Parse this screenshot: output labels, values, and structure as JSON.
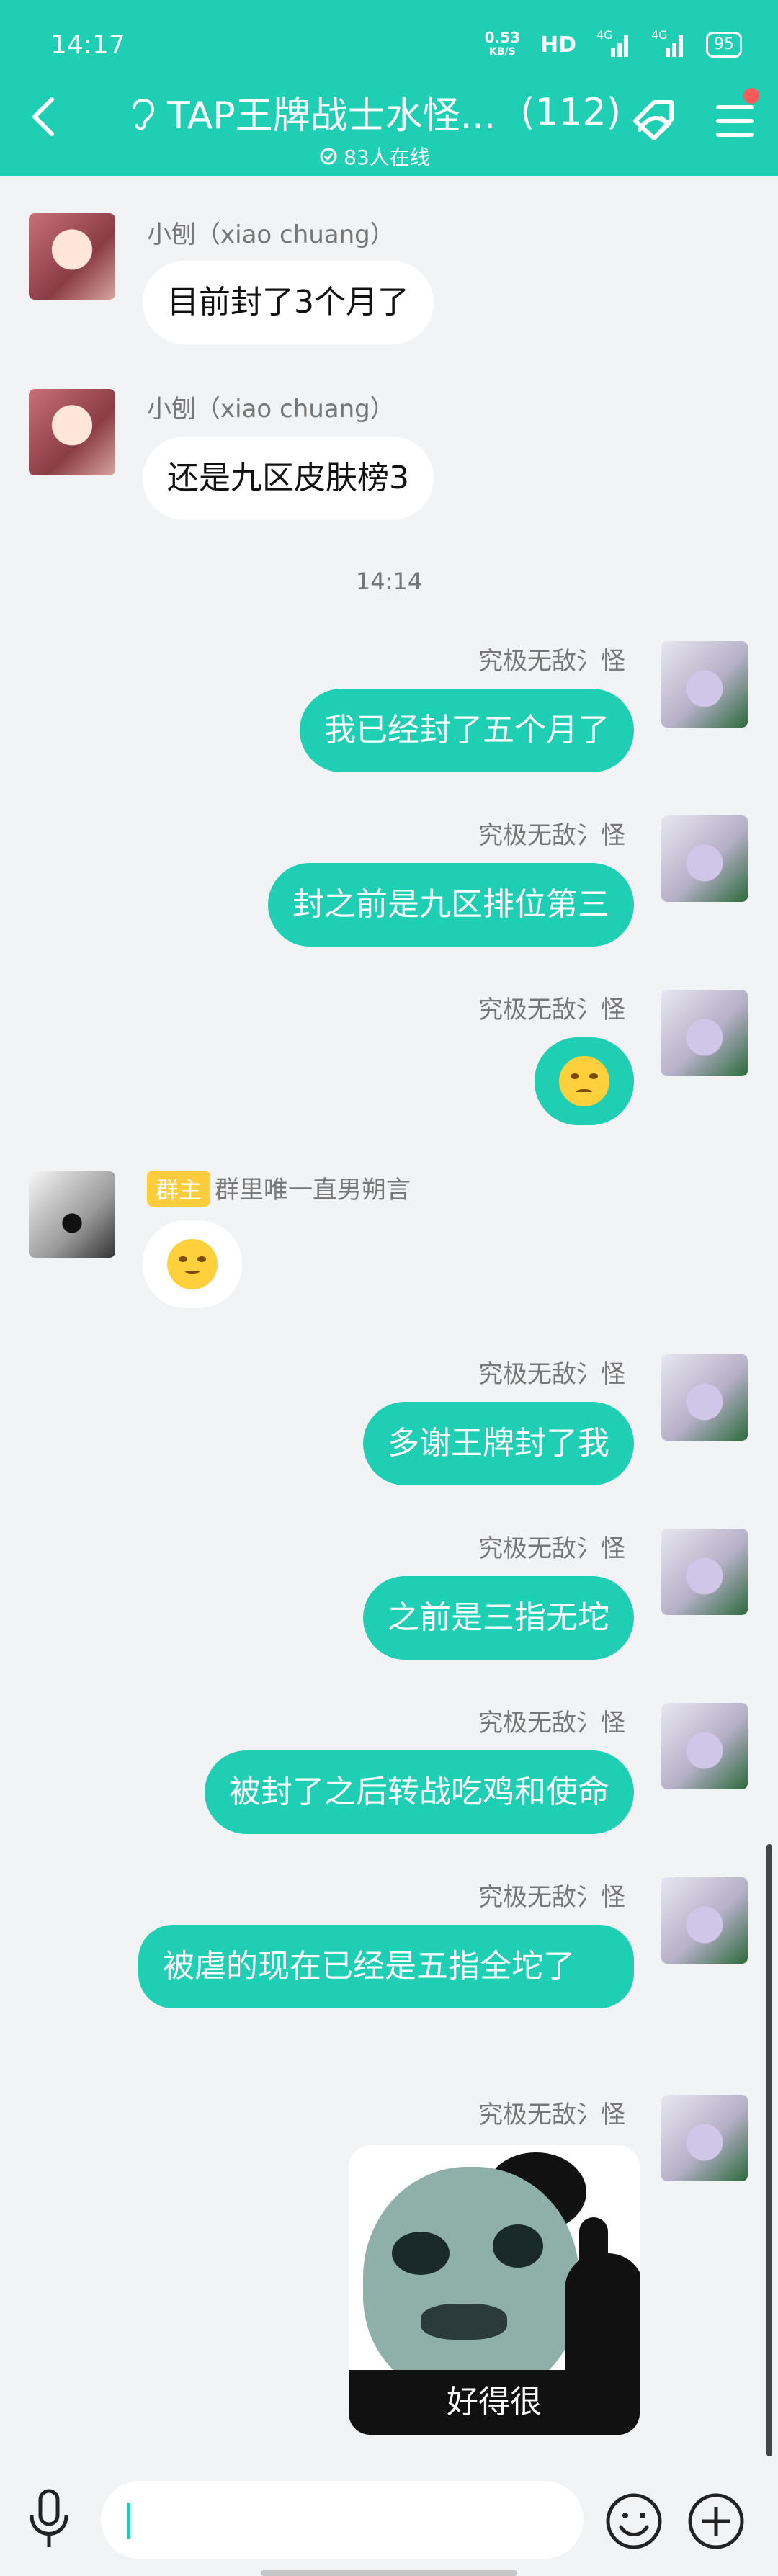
{
  "status": {
    "time": "14:17",
    "speed_value": "0.53",
    "speed_unit": "KB/S",
    "hd": "HD",
    "net1": "4G",
    "net2": "4G",
    "battery": "95"
  },
  "header": {
    "title": "TAP王牌战士水怪...",
    "count": "(112)",
    "online": "83人在线",
    "accent": "#1fcfb4"
  },
  "messages": [
    {
      "sender": "小刨（xiao chuang）",
      "text": "目前封了3个月了"
    },
    {
      "sender": "小刨（xiao chuang）",
      "text": "还是九区皮肤榜3"
    },
    {
      "sender": "究极无敌氵怪",
      "text": "我已经封了五个月了"
    },
    {
      "sender": "究极无敌氵怪",
      "text": "封之前是九区排位第三"
    },
    {
      "sender": "究极无敌氵怪",
      "emoji": "eyeroll-emoji"
    },
    {
      "badge": "群主",
      "sender": "群里唯一直男朔言",
      "emoji": "sweat-smile-emoji"
    },
    {
      "sender": "究极无敌氵怪",
      "text": "多谢王牌封了我"
    },
    {
      "sender": "究极无敌氵怪",
      "text": "之前是三指无坨"
    },
    {
      "sender": "究极无敌氵怪",
      "text": "被封了之后转战吃鸡和使命"
    },
    {
      "sender": "究极无敌氵怪",
      "text": "被虐的现在已经是五指全坨了"
    },
    {
      "sender": "究极无敌氵怪",
      "sticker_caption": "好得很"
    }
  ],
  "time_divider": "14:14",
  "input": {
    "placeholder": ""
  }
}
